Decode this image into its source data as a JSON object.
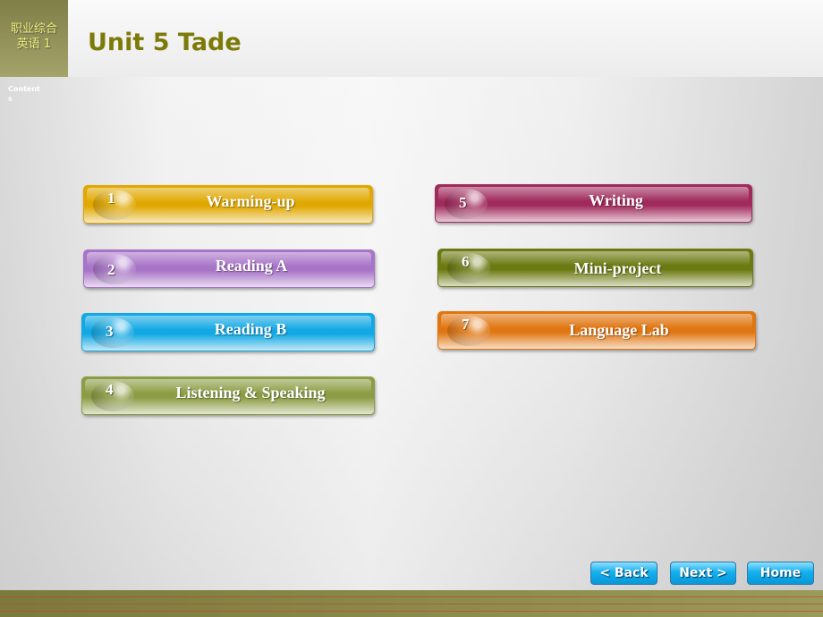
{
  "header": {
    "logo_line1": "职业综合",
    "logo_line2": "英语 1",
    "title": "Unit 5 Tade"
  },
  "sidebar": {
    "contents_label": "Contents"
  },
  "menu": [
    {
      "num": "1",
      "label": "Warming-up",
      "color": "#e0a800"
    },
    {
      "num": "2",
      "label": "Reading A",
      "color": "#a874c8"
    },
    {
      "num": "3",
      "label": "Reading B",
      "color": "#12a8e4"
    },
    {
      "num": "4",
      "label": "Listening & Speaking",
      "color": "#8c9c44"
    },
    {
      "num": "5",
      "label": "Writing",
      "color": "#a02a5c"
    },
    {
      "num": "6",
      "label": "Mini-project",
      "color": "#6c7a12"
    },
    {
      "num": "7",
      "label": "Language Lab",
      "color": "#e07612"
    }
  ],
  "nav": {
    "back": "< Back",
    "next": "Next >",
    "home": "Home"
  }
}
